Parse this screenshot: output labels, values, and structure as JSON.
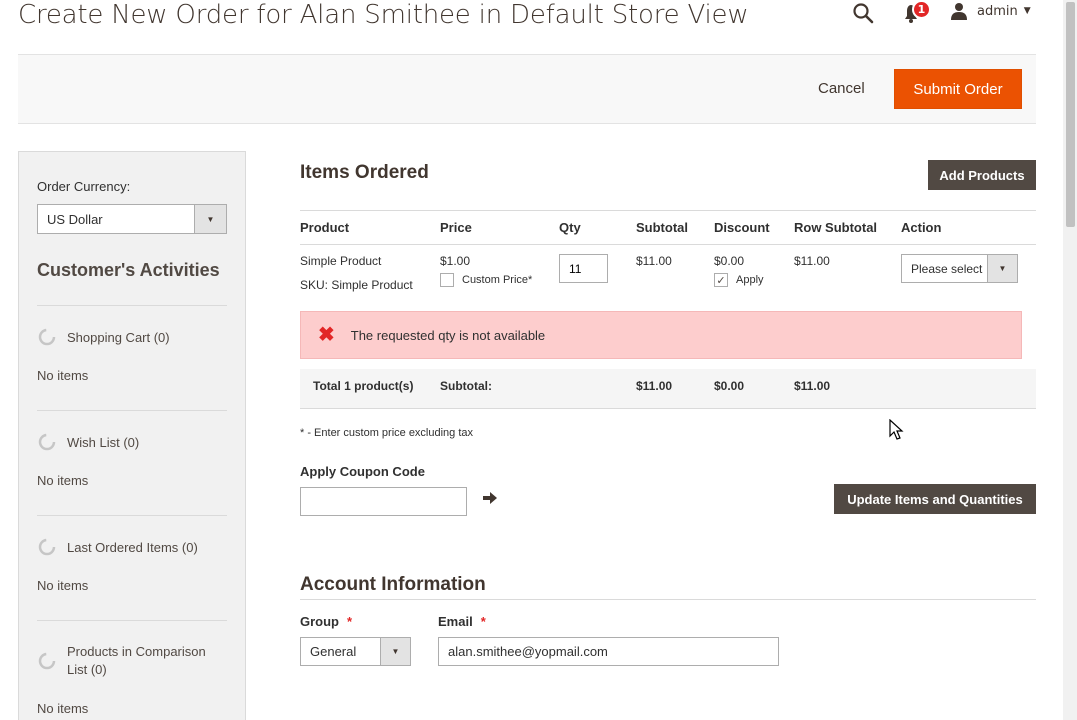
{
  "page": {
    "title": "Create New Order for Alan Smithee in Default Store View"
  },
  "header": {
    "notification_count": "1",
    "user_name": "admin"
  },
  "actions": {
    "cancel_label": "Cancel",
    "submit_label": "Submit Order"
  },
  "sidebar": {
    "currency_label": "Order Currency:",
    "currency_value": "US Dollar",
    "heading": "Customer's Activities",
    "sections": [
      {
        "label": "Shopping Cart (0)",
        "empty": "No items"
      },
      {
        "label": "Wish List (0)",
        "empty": "No items"
      },
      {
        "label": "Last Ordered Items (0)",
        "empty": "No items"
      },
      {
        "label": "Products in Comparison List (0)",
        "empty": "No items"
      }
    ]
  },
  "items": {
    "title": "Items Ordered",
    "add_products_label": "Add Products",
    "columns": [
      "Product",
      "Price",
      "Qty",
      "Subtotal",
      "Discount",
      "Row Subtotal",
      "Action"
    ],
    "row": {
      "product_name": "Simple Product",
      "sku": "SKU: Simple Product",
      "price": "$1.00",
      "custom_price_label": "Custom Price*",
      "qty": "11",
      "subtotal": "$11.00",
      "discount": "$0.00",
      "apply_label": "Apply",
      "row_subtotal": "$11.00",
      "action_placeholder": "Please select"
    },
    "error_message": "The requested qty is not available",
    "totals": {
      "label": "Total 1 product(s)",
      "subtotal_label": "Subtotal:",
      "subtotal": "$11.00",
      "discount": "$0.00",
      "row_subtotal": "$11.00"
    },
    "footnote": "* - Enter custom price excluding tax",
    "coupon_label": "Apply Coupon Code",
    "coupon_value": "",
    "update_label": "Update Items and Quantities"
  },
  "account": {
    "title": "Account Information",
    "group_label": "Group",
    "group_value": "General",
    "email_label": "Email",
    "email_value": "alan.smithee@yopmail.com"
  },
  "colors": {
    "accent": "#eb5202",
    "dark_button": "#514943",
    "error_bg": "#fdcdcd",
    "error_icon": "#e22626"
  }
}
